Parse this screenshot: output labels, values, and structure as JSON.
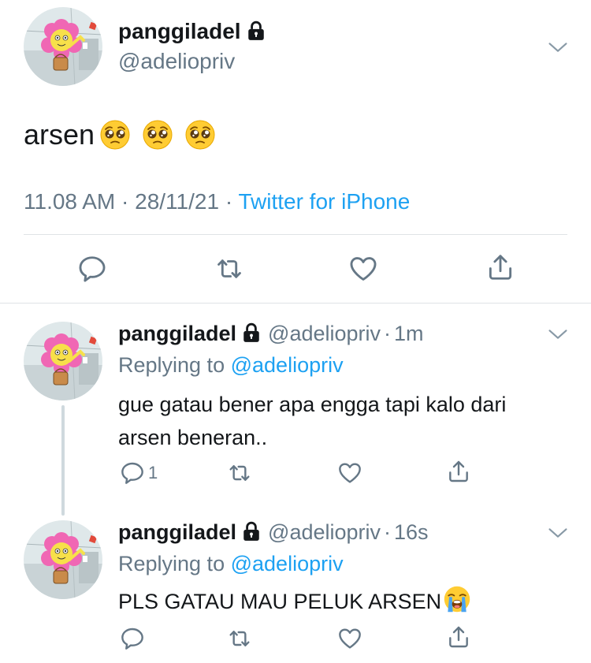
{
  "main_tweet": {
    "display_name": "panggiladel",
    "handle": "@adeliopriv",
    "text": "arsen",
    "emoji_count": 3,
    "emoji": "pleading-face",
    "time": "11.08 AM",
    "date": "28/11/21",
    "separator": "·",
    "source": "Twitter for iPhone"
  },
  "replies": [
    {
      "display_name": "panggiladel",
      "handle": "@adeliopriv",
      "age": "1m",
      "replying_prefix": "Replying to",
      "replying_to": "@adeliopriv",
      "text_line1": "gue gatau bener apa engga tapi kalo dari",
      "text_line2": "arsen beneran..",
      "reply_count": "1"
    },
    {
      "display_name": "panggiladel",
      "handle": "@adeliopriv",
      "age": "16s",
      "replying_prefix": "Replying to",
      "replying_to": "@adeliopriv",
      "text": "PLS GATAU MAU PELUK ARSEN",
      "emoji": "loudly-crying-face",
      "reply_count": ""
    }
  ],
  "colors": {
    "text": "#14171a",
    "secondary": "#657786",
    "link": "#1da1f2",
    "divider": "#dfe3e6"
  }
}
